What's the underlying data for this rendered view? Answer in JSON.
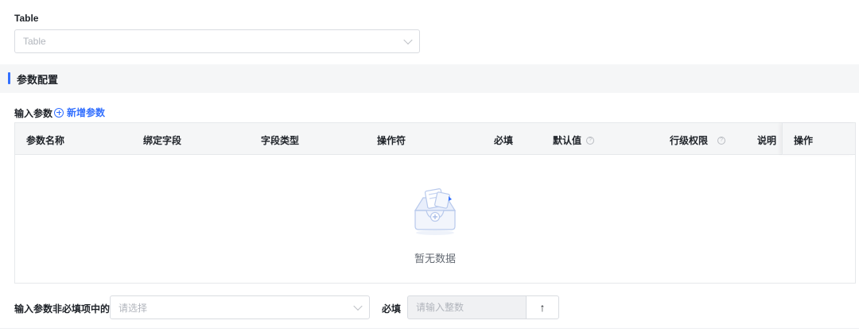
{
  "table_field": {
    "label": "Table",
    "placeholder": "Table"
  },
  "section": {
    "title": "参数配置"
  },
  "input_params": {
    "label": "输入参数",
    "add_label": "新增参数"
  },
  "table": {
    "columns": [
      "参数名称",
      "绑定字段",
      "字段类型",
      "操作符",
      "必填",
      "默认值",
      "行级权限",
      "说明",
      "操作"
    ],
    "empty_text": "暂无数据"
  },
  "optional_count": {
    "label": "输入参数非必填项中的",
    "placeholder": "请选择",
    "required_label": "必填",
    "number_placeholder": "请输入整数",
    "up_glyph": "↑"
  },
  "colors": {
    "accent": "#3370ff",
    "header_bg": "#f5f6f7",
    "border": "#e6e8eb"
  }
}
